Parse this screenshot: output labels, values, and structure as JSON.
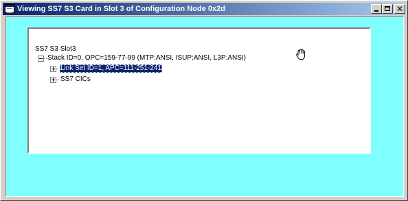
{
  "window": {
    "title": "Viewing SS7 S3 Card in Slot 3 of Configuration Node 0x2d"
  },
  "tree": {
    "root": {
      "label": "SS7 S3 Slot3"
    },
    "stack": {
      "label": "Stack ID=0, OPC=159-77-99  (MTP:ANSI,  ISUP:ANSI,  L3P:ANSI)",
      "expanded": true
    },
    "children": [
      {
        "label": "Link Set ID=1, APC=111-251-241",
        "selected": true,
        "expanded": false
      },
      {
        "label": "SS7 CICs",
        "selected": false,
        "expanded": false
      }
    ]
  },
  "icons": {
    "cursor": "hand-cursor-icon",
    "system_menu": "window-icon"
  },
  "colors": {
    "client_background": "#80ffff",
    "titlebar_start": "#0a246a",
    "titlebar_end": "#a6caf0",
    "selection": "#0a246a"
  }
}
